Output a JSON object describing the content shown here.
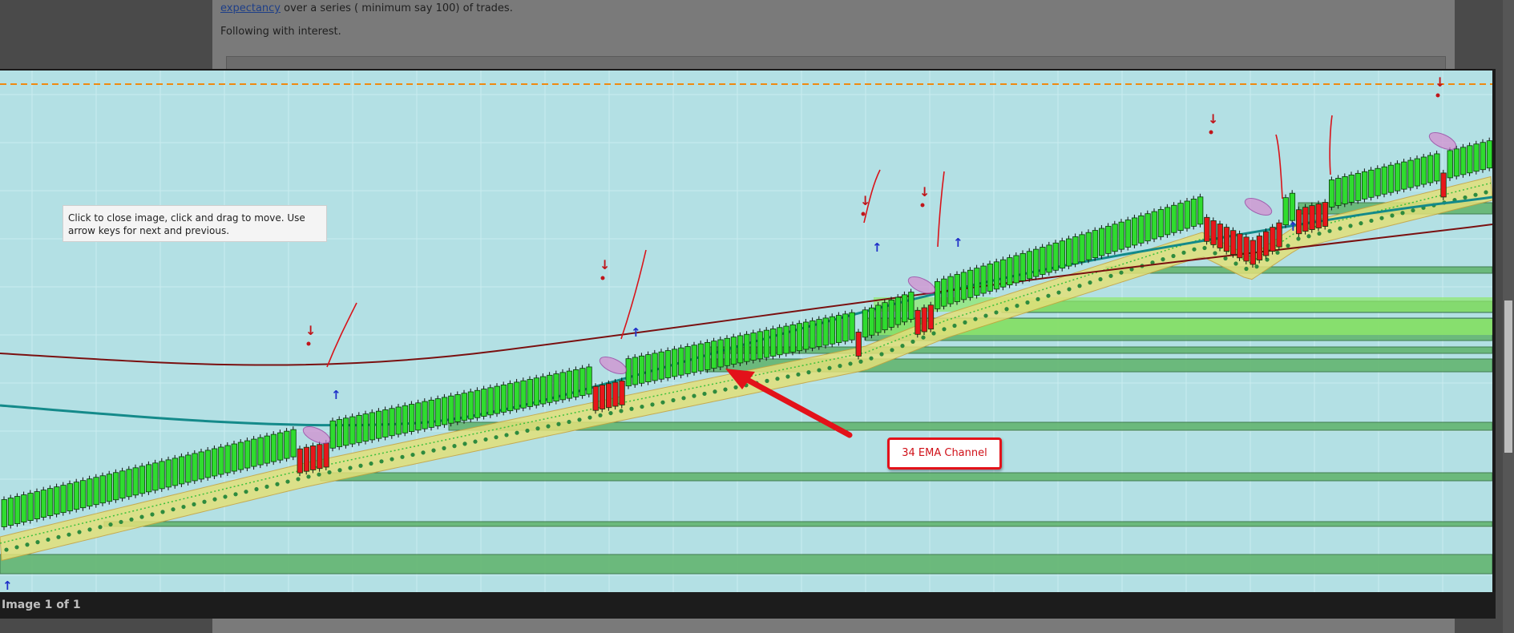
{
  "background_post": {
    "line1": "expectancy over a series ( minimum say 100) of trades.",
    "line1_link": "expectancy",
    "line1_rest": " over a series ( minimum say 100) of trades.",
    "line2": "Following with interest."
  },
  "lightbox": {
    "tooltip": "Click to close image, click and drag to move. Use arrow keys for next and previous.",
    "caption": "Image 1 of 1"
  },
  "chart": {
    "annotation": "34 EMA Channel",
    "colors": {
      "background": "#b3e0e4",
      "bull_candle": "#2fdc2f",
      "bear_candle": "#e8161b",
      "ema_band": "#e2e07a",
      "teal_line": "#148a8a",
      "maroon_line": "#7a1010",
      "dashed_line": "#f08a10",
      "zones": "#5fb36a",
      "arrow": "#e3121a"
    }
  }
}
